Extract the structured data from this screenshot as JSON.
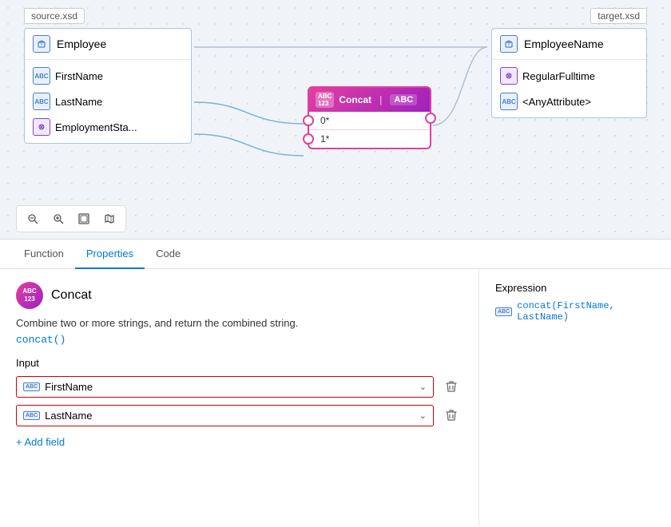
{
  "diagram": {
    "source_label": "source.xsd",
    "target_label": "target.xsd",
    "employee": {
      "label": "Employee",
      "children": [
        {
          "label": "FirstName",
          "icon": "abc"
        },
        {
          "label": "LastName",
          "icon": "abc"
        },
        {
          "label": "EmploymentSta...",
          "icon": "cross"
        }
      ]
    },
    "target": {
      "label": "EmployeeName",
      "children": [
        {
          "label": "RegularFulltime",
          "icon": "cross"
        },
        {
          "label": "<AnyAttribute>",
          "icon": "abc"
        }
      ]
    },
    "concat_box": {
      "title": "Concat",
      "abc_label": "ABC",
      "inputs": [
        "0*",
        "1*"
      ]
    },
    "toolbar": {
      "zoom_out": "−",
      "zoom_in": "+",
      "fit": "⊡",
      "map": "⊞"
    }
  },
  "tabs": [
    {
      "label": "Function",
      "active": false
    },
    {
      "label": "Properties",
      "active": true
    },
    {
      "label": "Code",
      "active": false
    }
  ],
  "function_panel": {
    "icon_text": "ABC\n123",
    "name": "Concat",
    "description": "Combine two or more strings, and return the combined string.",
    "syntax": "concat()",
    "input_label": "Input",
    "fields": [
      {
        "icon": "ABC",
        "value": "FirstName"
      },
      {
        "icon": "ABC",
        "value": "LastName"
      }
    ],
    "add_field_label": "+ Add field",
    "delete_icon": "🗑"
  },
  "expression_panel": {
    "label": "Expression",
    "icon": "ABC",
    "value": "concat(FirstName, LastName)"
  }
}
